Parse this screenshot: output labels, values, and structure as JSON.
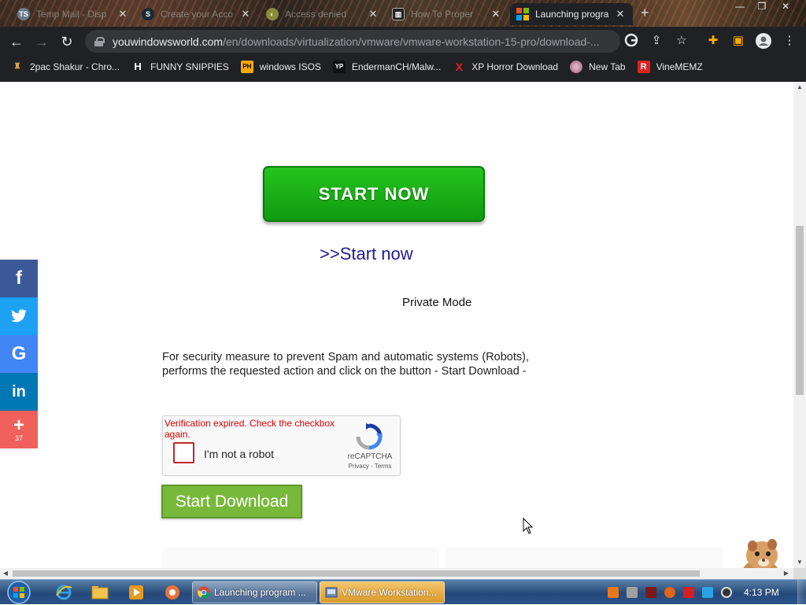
{
  "browser": {
    "tabs": [
      {
        "label": "Temp Mail - Disp",
        "icon": "temp-mail-icon"
      },
      {
        "label": "Create your Acco",
        "icon": "steam-icon"
      },
      {
        "label": "Access denied",
        "icon": "globe-icon"
      },
      {
        "label": "How To Proper",
        "icon": "site-icon"
      },
      {
        "label": "Launching progra",
        "icon": "windows-logo-icon",
        "active": true
      }
    ],
    "window_controls": [
      "minimize",
      "maximize",
      "close"
    ],
    "url_host": "youwindowsworld.com",
    "url_path": "/en/downloads/virtualization/vmware/vmware-workstation-15-pro/download-..."
  },
  "bookmarks": [
    {
      "label": "2pac Shakur - Chro...",
      "icon": "bookmark-2pac-icon"
    },
    {
      "label": "FUNNY SNIPPIES",
      "icon": "bookmark-h-icon"
    },
    {
      "label": "windows ISOS",
      "icon": "bookmark-ph-icon"
    },
    {
      "label": "EndermanCH/Malw...",
      "icon": "bookmark-yp-icon"
    },
    {
      "label": "XP Horror Download",
      "icon": "bookmark-x-icon"
    },
    {
      "label": "New Tab",
      "icon": "bookmark-newtab-icon"
    },
    {
      "label": "VineMEMZ",
      "icon": "bookmark-r-icon"
    }
  ],
  "page": {
    "start_now_button": "START NOW",
    "start_now_link": ">>Start now",
    "private_mode": "Private Mode",
    "security_text": "For security measure to prevent Spam and automatic systems (Robots), performs the requested action and click on the button - Start Download -",
    "recaptcha": {
      "error": "Verification expired. Check the checkbox again.",
      "label": "I'm not a robot",
      "brand": "reCAPTCHA",
      "privacy": "Privacy",
      "separator": " - ",
      "terms": "Terms"
    },
    "start_download_button": "Start Download"
  },
  "share_bar": {
    "facebook": "f",
    "twitter": "t",
    "google": "G",
    "linkedin": "in",
    "plus": "+",
    "count": "37"
  },
  "taskbar": {
    "tasks": [
      {
        "label": "Launching program ...",
        "icon": "chrome-icon"
      },
      {
        "label": "VMware Workstation...",
        "icon": "vmware-icon"
      }
    ],
    "clock": "4:13 PM"
  },
  "colors": {
    "start_now_green": "#1db31a",
    "start_download_green": "#78b83a",
    "link_blue": "#1f1d8f",
    "error_red": "#dd0000",
    "chrome_dark": "#202124"
  }
}
